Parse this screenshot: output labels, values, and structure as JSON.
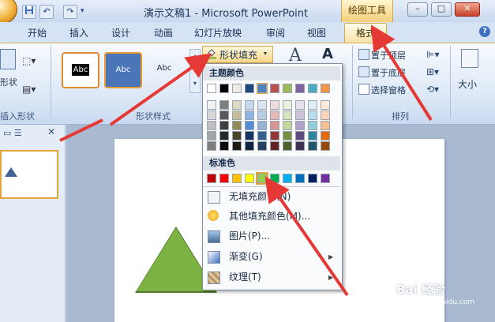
{
  "window": {
    "title": "演示文稿1 - Microsoft PowerPoint",
    "context_tab_group": "绘图工具"
  },
  "qat": {
    "undo": "↶",
    "redo": "↷"
  },
  "tabs": [
    "开始",
    "插入",
    "设计",
    "动画",
    "幻灯片放映",
    "审阅",
    "视图"
  ],
  "active_tab": "格式",
  "ribbon": {
    "insert_shapes_label": "插入形状",
    "shape_button_label": "形状",
    "shape_style_label": "形状样式",
    "style_presets": [
      {
        "label": "Abc",
        "bg": "#ffffff",
        "border": "#e08a2e",
        "fg": "#222222"
      },
      {
        "label": "Abc",
        "bg": "#000000",
        "border": "#000000",
        "fg": "#ffffff"
      },
      {
        "label": "Abc",
        "bg": "#4a76b8",
        "border": "#e89b36",
        "fg": "#ffffff"
      }
    ],
    "shape_fill_label": "形状填充",
    "arrange_items": [
      "置于顶层",
      "置于底层",
      "选择窗格"
    ],
    "arrange_label": "排列",
    "size_label": "大小"
  },
  "fill_menu": {
    "theme_colors_header": "主题颜色",
    "standard_colors_header": "标准色",
    "theme_colors": [
      [
        "#ffffff",
        "#000000",
        "#eeece1",
        "#1f497d",
        "#4f81bd",
        "#c0504d",
        "#9bbb59",
        "#8064a2",
        "#4bacc6",
        "#f79646"
      ],
      [
        "#f2f2f2",
        "#7f7f7f",
        "#ddd9c3",
        "#c6d9f0",
        "#dbe5f1",
        "#f2dcdb",
        "#ebf1dd",
        "#e5e0ec",
        "#dbeef3",
        "#fdeada"
      ],
      [
        "#d8d8d8",
        "#595959",
        "#c4bd97",
        "#8db3e2",
        "#b8cce4",
        "#e5b9b7",
        "#d7e3bc",
        "#ccc1d9",
        "#b7dde8",
        "#fbd5b5"
      ],
      [
        "#bfbfbf",
        "#3f3f3f",
        "#938953",
        "#548dd4",
        "#95b3d7",
        "#d99694",
        "#c3d69b",
        "#b2a2c7",
        "#92cddc",
        "#fac08f"
      ],
      [
        "#a5a5a5",
        "#262626",
        "#494429",
        "#17365d",
        "#366092",
        "#953734",
        "#76923c",
        "#5f497a",
        "#31859b",
        "#e36c09"
      ],
      [
        "#7f7f7f",
        "#0c0c0c",
        "#1d1b10",
        "#0f243e",
        "#244061",
        "#632423",
        "#4f6128",
        "#3f3151",
        "#205867",
        "#974806"
      ]
    ],
    "standard_colors": [
      "#c00000",
      "#ff0000",
      "#ffc000",
      "#ffff00",
      "#92d050",
      "#00b050",
      "#00b0f0",
      "#0070c0",
      "#002060",
      "#7030a0"
    ],
    "items": [
      {
        "label": "无填充颜色(N)",
        "has_submenu": false
      },
      {
        "label": "其他填充颜色(M)...",
        "has_submenu": false
      },
      {
        "label": "图片(P)...",
        "has_submenu": false
      },
      {
        "label": "渐变(G)",
        "has_submenu": true
      },
      {
        "label": "纹理(T)",
        "has_submenu": true
      }
    ]
  },
  "slide": {
    "shape_color": "#7cb342"
  },
  "watermark": {
    "brand": "Bai 经验",
    "url": "jingyan.baidu.com"
  },
  "annotation_color": "#e53935"
}
